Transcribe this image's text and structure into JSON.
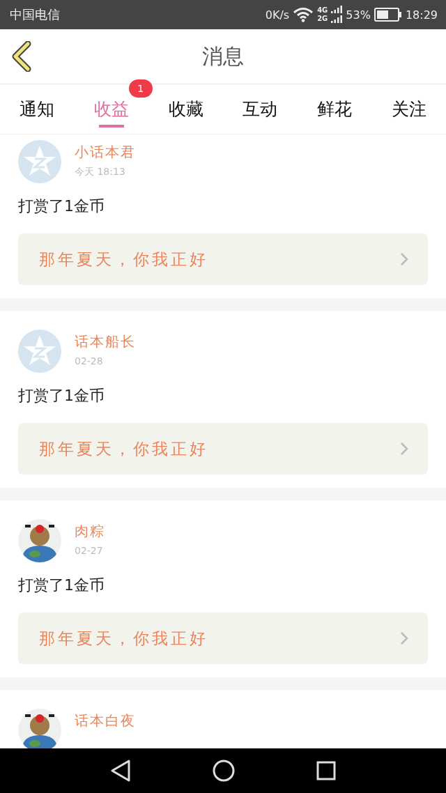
{
  "status_bar": {
    "carrier": "中国电信",
    "speed": "0K/s",
    "network_labels": [
      "4G",
      "2G"
    ],
    "battery": "53%",
    "time": "18:29"
  },
  "header": {
    "title": "消息"
  },
  "tabs": [
    {
      "label": "通知",
      "selected": false
    },
    {
      "label": "收益",
      "selected": true,
      "badge": "1"
    },
    {
      "label": "收藏",
      "selected": false
    },
    {
      "label": "互动",
      "selected": false
    },
    {
      "label": "鲜花",
      "selected": false
    },
    {
      "label": "关注",
      "selected": false
    }
  ],
  "messages": [
    {
      "kind": "default",
      "name": "小话本君",
      "time": "今天 18:13",
      "text": "打赏了1金币",
      "quote": "那年夏天，你我正好"
    },
    {
      "kind": "default",
      "name": "话本船长",
      "time": "02-28",
      "text": "打赏了1金币",
      "quote": "那年夏天，你我正好"
    },
    {
      "kind": "picture",
      "name": "肉粽",
      "time": "02-27",
      "text": "打赏了1金币",
      "quote": "那年夏天，你我正好"
    },
    {
      "kind": "picture",
      "name": "话本白夜"
    }
  ]
}
